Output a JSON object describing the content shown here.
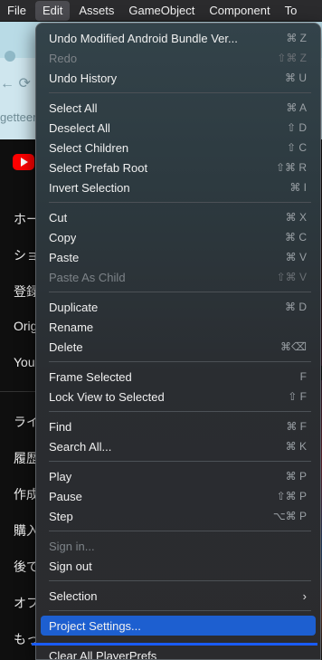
{
  "menubar": {
    "items": [
      "File",
      "Edit",
      "Assets",
      "GameObject",
      "Component",
      "To"
    ]
  },
  "background": {
    "nav_arrows": "← ⟳",
    "url_fragment": "getteer",
    "sidebar_items": [
      "ホー",
      "ショ",
      "登録",
      "Origi",
      "You",
      "ライ",
      "履歴",
      "作成",
      "購入",
      "後で",
      "オフ",
      "もっ"
    ]
  },
  "menu": {
    "items": [
      {
        "label": "Undo Modified Android Bundle Ver...",
        "shortcut": "⌘ Z"
      },
      {
        "label": "Redo",
        "shortcut": "⇧⌘ Z"
      },
      {
        "label": "Undo History",
        "shortcut": "⌘ U"
      },
      {
        "label": "Select All",
        "shortcut": "⌘ A"
      },
      {
        "label": "Deselect All",
        "shortcut": "⇧ D"
      },
      {
        "label": "Select Children",
        "shortcut": "⇧ C"
      },
      {
        "label": "Select Prefab Root",
        "shortcut": "⇧⌘ R"
      },
      {
        "label": "Invert Selection",
        "shortcut": "⌘ I"
      },
      {
        "label": "Cut",
        "shortcut": "⌘ X"
      },
      {
        "label": "Copy",
        "shortcut": "⌘ C"
      },
      {
        "label": "Paste",
        "shortcut": "⌘ V"
      },
      {
        "label": "Paste As Child",
        "shortcut": "⇧⌘ V"
      },
      {
        "label": "Duplicate",
        "shortcut": "⌘ D"
      },
      {
        "label": "Rename",
        "shortcut": ""
      },
      {
        "label": "Delete",
        "shortcut": "⌘⌫"
      },
      {
        "label": "Frame Selected",
        "shortcut": "F"
      },
      {
        "label": "Lock View to Selected",
        "shortcut": "⇧ F"
      },
      {
        "label": "Find",
        "shortcut": "⌘ F"
      },
      {
        "label": "Search All...",
        "shortcut": "⌘ K"
      },
      {
        "label": "Play",
        "shortcut": "⌘ P"
      },
      {
        "label": "Pause",
        "shortcut": "⇧⌘ P"
      },
      {
        "label": "Step",
        "shortcut": "⌥⌘ P"
      },
      {
        "label": "Sign in...",
        "shortcut": ""
      },
      {
        "label": "Sign out",
        "shortcut": ""
      },
      {
        "label": "Selection",
        "shortcut": "›"
      },
      {
        "label": "Project Settings...",
        "shortcut": ""
      },
      {
        "label": "Clear All PlayerPrefs",
        "shortcut": ""
      }
    ]
  }
}
